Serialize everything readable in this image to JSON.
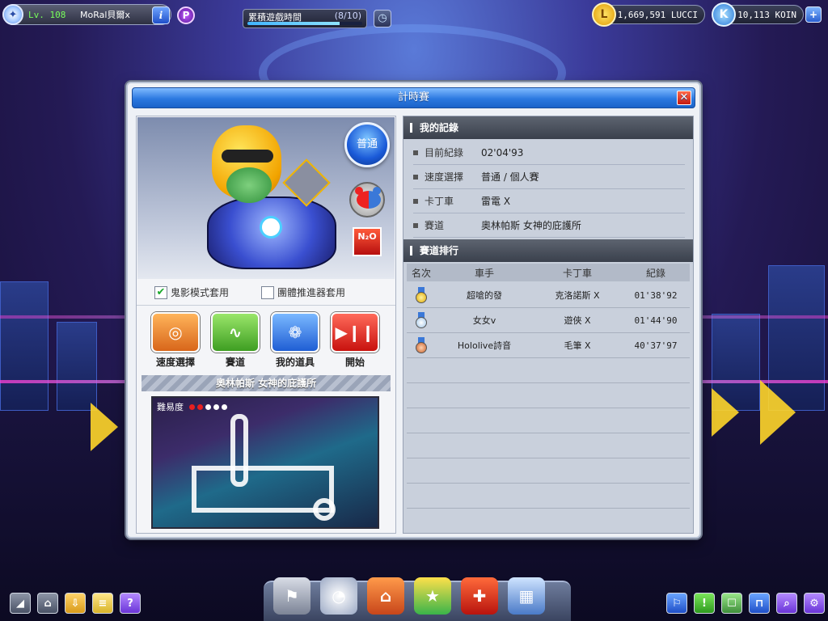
{
  "hud": {
    "level": "Lv. 108",
    "nickname": "MoRal貝爾x",
    "info_label": "i",
    "p_label": "P",
    "play_time": {
      "label": "累積遊戲時間",
      "count": "(8/10)",
      "current": 8,
      "max": 10
    },
    "lucci": "1,669,591 LUCCI",
    "koin": "10,113 KOIN",
    "lucci_icon_glyph": "L",
    "koin_icon_glyph": "K",
    "plus_label": "+"
  },
  "dialog": {
    "title": "計時賽",
    "close_label": "✕",
    "mode_label": "普通",
    "n2o_label": "N₂O",
    "options": {
      "ghost_label": "鬼影模式套用",
      "ghost_checked": true,
      "team_boost_label": "團體推進器套用",
      "team_boost_checked": false
    },
    "actions": [
      {
        "label": "速度選擇",
        "color": "#e8842a"
      },
      {
        "label": "賽道",
        "color": "#5cc23a"
      },
      {
        "label": "我的道具",
        "color": "#2f7ce8"
      },
      {
        "label": "開始",
        "color": "#e02a2a"
      }
    ],
    "track_name": "奧林帕斯  女神的庇護所",
    "difficulty_label": "難易度",
    "difficulty_level": 2,
    "difficulty_max": 5,
    "my_record": {
      "heading": "我的記錄",
      "rows": [
        {
          "key": "目前紀錄",
          "value": "02'04'93"
        },
        {
          "key": "速度選擇",
          "value": "普通 / 個人賽"
        },
        {
          "key": "卡丁車",
          "value": "雷電 X"
        },
        {
          "key": "賽道",
          "value": "奧林帕斯 女神的庇護所"
        }
      ]
    },
    "ranking": {
      "heading": "賽道排行",
      "columns": [
        "名次",
        "車手",
        "卡丁車",
        "紀錄"
      ],
      "rows": [
        {
          "medal": "gold",
          "driver": "超嗆的發",
          "kart": "克洛諾斯 X",
          "time": "01'38'92"
        },
        {
          "medal": "silver",
          "driver": "女女v",
          "kart": "遊俠 X",
          "time": "01'44'90"
        },
        {
          "medal": "bronze",
          "driver": "Hololive詩音",
          "kart": "毛筆 X",
          "time": "40'37'97"
        }
      ]
    }
  },
  "colors": {
    "title_blue": "#2c79e0",
    "gold": "#f2c21a",
    "silver": "#cfe2f5",
    "bronze": "#e08a52"
  }
}
